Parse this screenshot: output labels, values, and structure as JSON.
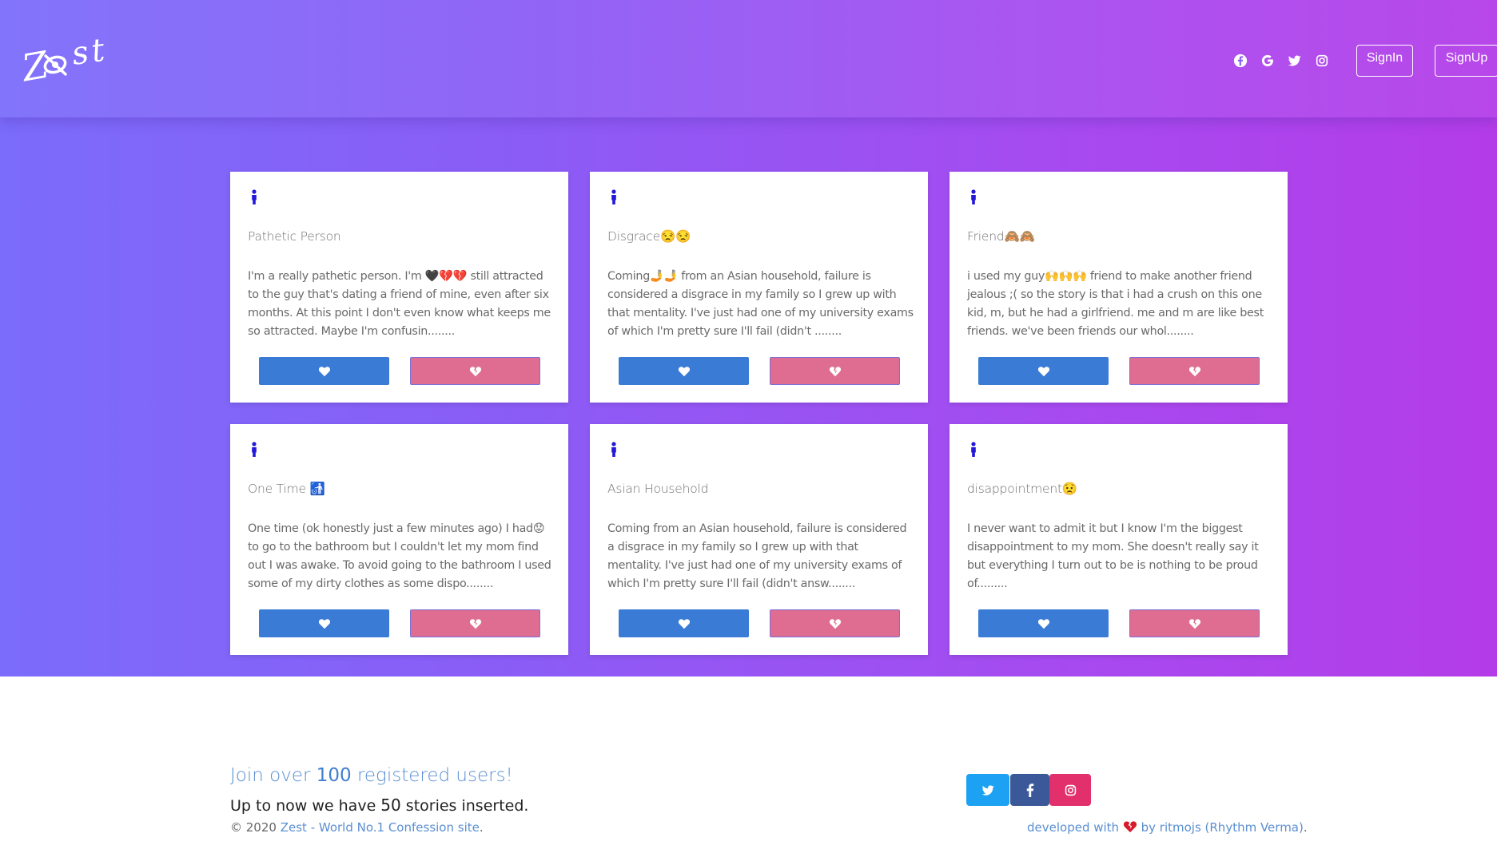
{
  "brand": {
    "logo_text_left": "Z",
    "logo_text_right": "st",
    "colors": {
      "gradient_start": "#7b6cfb",
      "gradient_end": "#b43ce8"
    }
  },
  "header": {
    "social_icons": [
      "facebook-icon",
      "google-icon",
      "twitter-icon",
      "instagram-icon"
    ],
    "signin_label": "SignIn",
    "signup_label": "SignUp"
  },
  "cards": [
    {
      "title": "Pathetic Person",
      "body": "I'm a really pathetic person. I'm 🖤💔💔 still attracted to the guy that's dating a friend of mine, even after six months. At this point I don't even know what keeps me so attracted. Maybe I'm confusin........"
    },
    {
      "title": "Disgrace😒😒",
      "body": "Coming🤳🤳 from an Asian household, failure is considered a disgrace in my family so I grew up with that mentality. I've just had one of my university exams of which I'm pretty sure I'll fail (didn't ........"
    },
    {
      "title": "Friend🙈🙈",
      "body": "i used my guy🙌🙌🙌 friend to make another friend jealous ;( so the story is that i had a crush on this one kid, m, but he had a girlfriend. me and m are like best friends. we've been friends our whol........"
    },
    {
      "title": "One Time 🚮",
      "body": "One time (ok honestly just a few minutes ago) I had😟 to go to the bathroom but I couldn't let my mom find out I was awake. To avoid going to the bathroom I used some of my dirty clothes as some dispo........"
    },
    {
      "title": "Asian Household",
      "body": "Coming from an Asian household, failure is considered a disgrace in my family so I grew up with that mentality. I've just had one of my university exams of which I'm pretty sure I'll fail (didn't answ........"
    },
    {
      "title": "disappointment😟",
      "body": "I never want to admit it but I know I'm the biggest disappointment to my mom. She doesn't really say it but everything I turn out to be is nothing to be proud of........."
    }
  ],
  "footer": {
    "join_prefix": "Join over ",
    "user_count": "100",
    "join_suffix": " registered users!",
    "stories_prefix": "Up to now we have ",
    "story_count": "50",
    "stories_suffix": " stories inserted.",
    "copyright": "© 2020 ",
    "site_name": "Zest - World No.1 Confession site",
    "period": ".",
    "dev_prefix": "developed with ",
    "dev_suffix": " by ritmojs (Rhythm Verma)",
    "dev_period": ".",
    "social_buttons": [
      {
        "icon": "twitter-icon",
        "color": "#1da1f2"
      },
      {
        "icon": "facebook-icon",
        "color": "#3b5998"
      },
      {
        "icon": "instagram-icon",
        "color": "#e1306c"
      }
    ]
  }
}
